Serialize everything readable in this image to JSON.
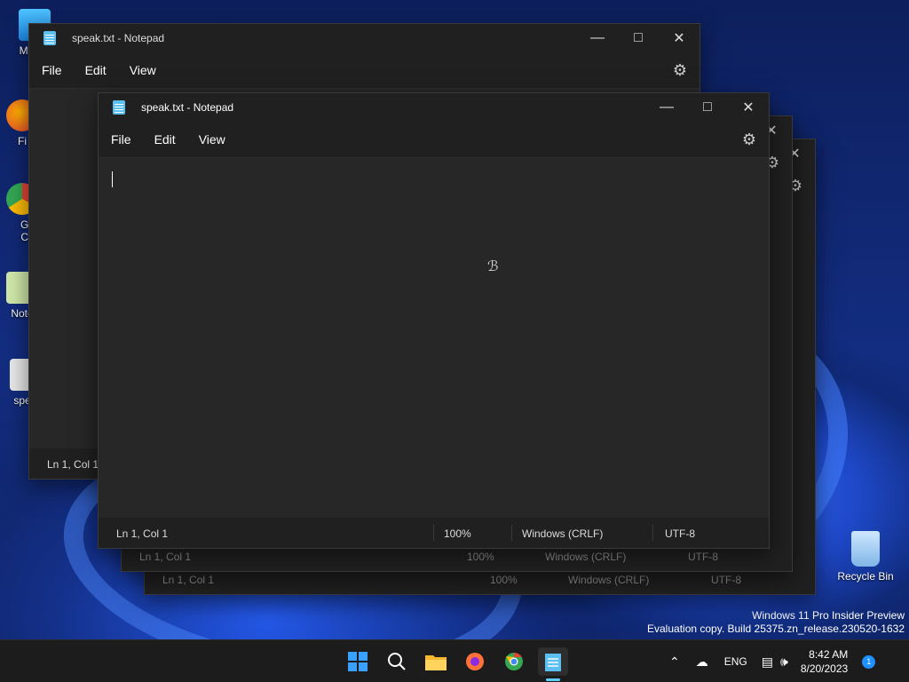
{
  "desktop": {
    "icons": [
      {
        "label": "My Co"
      },
      {
        "label": "Fi"
      },
      {
        "label": "Go Ch"
      },
      {
        "label": "Note"
      },
      {
        "label": "spe"
      },
      {
        "label": "Recycle Bin"
      }
    ],
    "watermark": {
      "line1": "Windows 11 Pro Insider Preview",
      "line2": "Evaluation copy. Build 25375.zn_release.230520-1632"
    }
  },
  "windows": {
    "back": {
      "title": "speak.txt - Notepad",
      "menus": [
        "File",
        "Edit",
        "View"
      ],
      "status_position": "Ln 1, Col 1"
    },
    "mid1": {
      "status_position": "Ln 1, Col 1",
      "status_zoom": "100%",
      "status_eol": "Windows (CRLF)",
      "status_encoding": "UTF-8"
    },
    "mid2": {
      "status_position": "Ln 1, Col 1",
      "status_zoom": "100%",
      "status_eol": "Windows (CRLF)",
      "status_encoding": "UTF-8"
    },
    "front": {
      "title": "speak.txt - Notepad",
      "menus": [
        "File",
        "Edit",
        "View"
      ],
      "content": "",
      "status_position": "Ln 1, Col 1",
      "status_zoom": "100%",
      "status_eol": "Windows (CRLF)",
      "status_encoding": "UTF-8"
    }
  },
  "taskbar": {
    "apps": [
      "start-icon",
      "search-icon",
      "file-explorer-icon",
      "firefox-icon",
      "chrome-icon",
      "notepad-icon"
    ],
    "tray": {
      "language": "ENG",
      "time": "8:42 AM",
      "date": "8/20/2023",
      "notification_count": "1"
    }
  }
}
